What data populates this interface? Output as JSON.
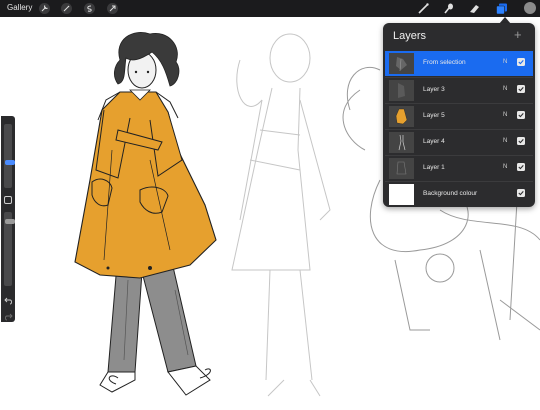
{
  "toolbar": {
    "gallery_label": "Gallery",
    "left_tools": [
      "wrench-icon",
      "magic-wand-icon",
      "selection-icon",
      "transform-arrow-icon"
    ],
    "right_tools": [
      "brush-icon",
      "smudge-icon",
      "eraser-icon",
      "layers-icon"
    ],
    "accent": "#1a6bf0"
  },
  "layers_panel": {
    "title": "Layers",
    "add_label": "+",
    "layers": [
      {
        "name": "From selection",
        "blend": "N",
        "visible": true,
        "active": true
      },
      {
        "name": "Layer 3",
        "blend": "N",
        "visible": true,
        "active": false
      },
      {
        "name": "Layer 5",
        "blend": "N",
        "visible": true,
        "active": false
      },
      {
        "name": "Layer 4",
        "blend": "N",
        "visible": true,
        "active": false
      },
      {
        "name": "Layer 1",
        "blend": "N",
        "visible": true,
        "active": false
      },
      {
        "name": "Background colour",
        "blend": "",
        "visible": true,
        "active": false
      }
    ]
  },
  "sidebar": {
    "undo_icon": "undo-icon",
    "redo_icon": "redo-icon",
    "modify_icon": "square-modify-icon"
  },
  "canvas": {
    "coat_color": "#e6a02e",
    "pants_color": "#8d8d8d",
    "hair_color": "#3a3a3a"
  }
}
